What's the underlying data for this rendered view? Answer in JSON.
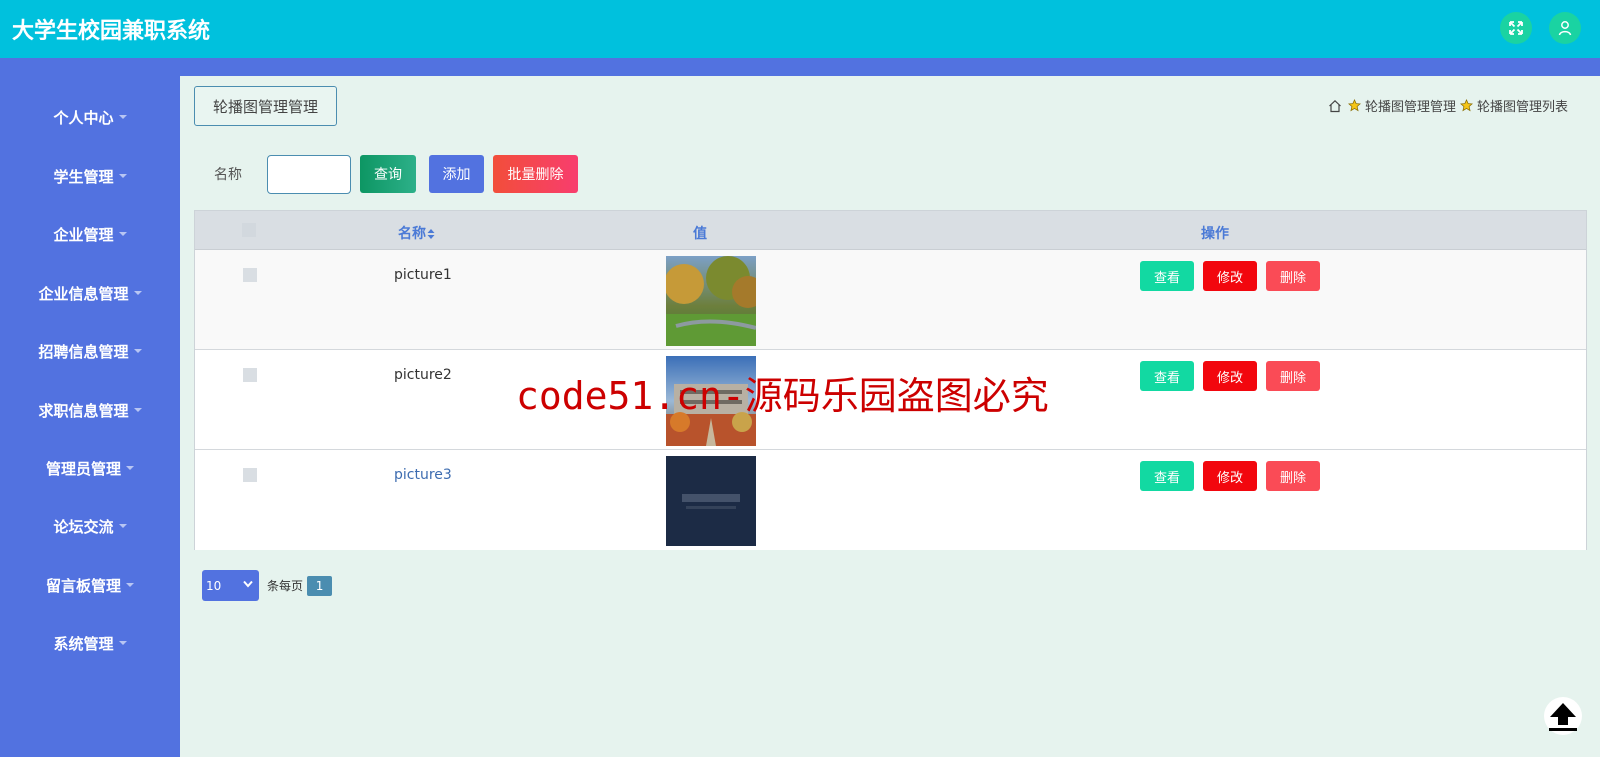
{
  "app": {
    "title": "大学生校园兼职系统"
  },
  "header": {
    "fullscreen_icon": "fullscreen-icon",
    "user_icon": "user-icon"
  },
  "sidebar": {
    "items": [
      {
        "label": "个人中心"
      },
      {
        "label": "学生管理"
      },
      {
        "label": "企业管理"
      },
      {
        "label": "企业信息管理"
      },
      {
        "label": "招聘信息管理"
      },
      {
        "label": "求职信息管理"
      },
      {
        "label": "管理员管理"
      },
      {
        "label": "论坛交流"
      },
      {
        "label": "留言板管理"
      },
      {
        "label": "系统管理"
      }
    ]
  },
  "page": {
    "title": "轮播图管理管理",
    "breadcrumb": [
      "轮播图管理管理",
      "轮播图管理列表"
    ]
  },
  "search": {
    "label": "名称",
    "value": "",
    "query_label": "查询",
    "add_label": "添加",
    "batch_delete_label": "批量删除"
  },
  "table": {
    "columns": [
      "名称",
      "值",
      "操作"
    ],
    "rows": [
      {
        "name": "picture1",
        "image": "campus-trees-photo",
        "view": "查看",
        "edit": "修改",
        "delete": "删除"
      },
      {
        "name": "picture2",
        "image": "campus-building-photo",
        "view": "查看",
        "edit": "修改",
        "delete": "删除"
      },
      {
        "name": "picture3",
        "image": "dark-banner-photo",
        "view": "查看",
        "edit": "修改",
        "delete": "删除"
      }
    ]
  },
  "pagination": {
    "page_size": "10",
    "per_page_label": "条每页",
    "current_page": "1"
  },
  "watermark": "code51.cn-源码乐园盗图必究",
  "colors": {
    "topbar": "#00c1dd",
    "sidebar": "#5272e0",
    "background": "#e6f3ee"
  }
}
